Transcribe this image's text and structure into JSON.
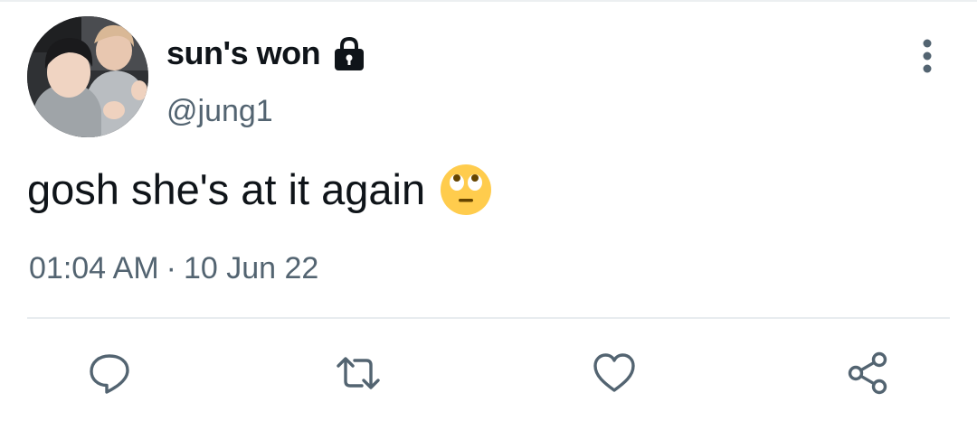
{
  "tweet": {
    "display_name": "sun's won",
    "handle": "@jung1",
    "text": "gosh she's at it again",
    "time": "01:04 AM",
    "separator": "·",
    "date": "10 Jun 22"
  },
  "icons": {
    "protected": "lock-icon",
    "more": "more-vertical-icon",
    "emoji": "face-with-rolling-eyes-emoji",
    "reply": "reply-icon",
    "retweet": "retweet-icon",
    "like": "heart-icon",
    "share": "share-icon"
  },
  "colors": {
    "text_primary": "#0f1419",
    "text_secondary": "#536471",
    "icon": "#536471",
    "divider": "#e8ecef",
    "emoji_face": "#ffcc4d"
  }
}
